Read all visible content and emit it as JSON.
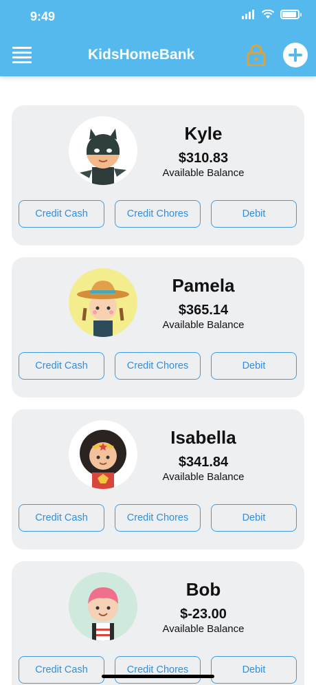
{
  "status_bar": {
    "time": "9:49"
  },
  "header": {
    "title": "KidsHomeBank",
    "menu_icon": "menu-icon",
    "lock_icon": "lock-icon",
    "add_icon": "add-icon"
  },
  "colors": {
    "header": "#56b9ee",
    "card": "#eeeff1",
    "button": "#3d9be6",
    "lock": "#e0a237"
  },
  "balance_label": "Available Balance",
  "buttons": {
    "credit_cash": "Credit Cash",
    "credit_chores": "Credit Chores",
    "debit": "Debit"
  },
  "kids": [
    {
      "name": "Kyle",
      "balance": "$310.83",
      "avatar": "batman-avatar"
    },
    {
      "name": "Pamela",
      "balance": "$365.14",
      "avatar": "cowgirl-avatar"
    },
    {
      "name": "Isabella",
      "balance": "$341.84",
      "avatar": "wonder-girl-avatar"
    },
    {
      "name": "Bob",
      "balance": "$-23.00",
      "avatar": "pink-hair-boy-avatar"
    }
  ]
}
